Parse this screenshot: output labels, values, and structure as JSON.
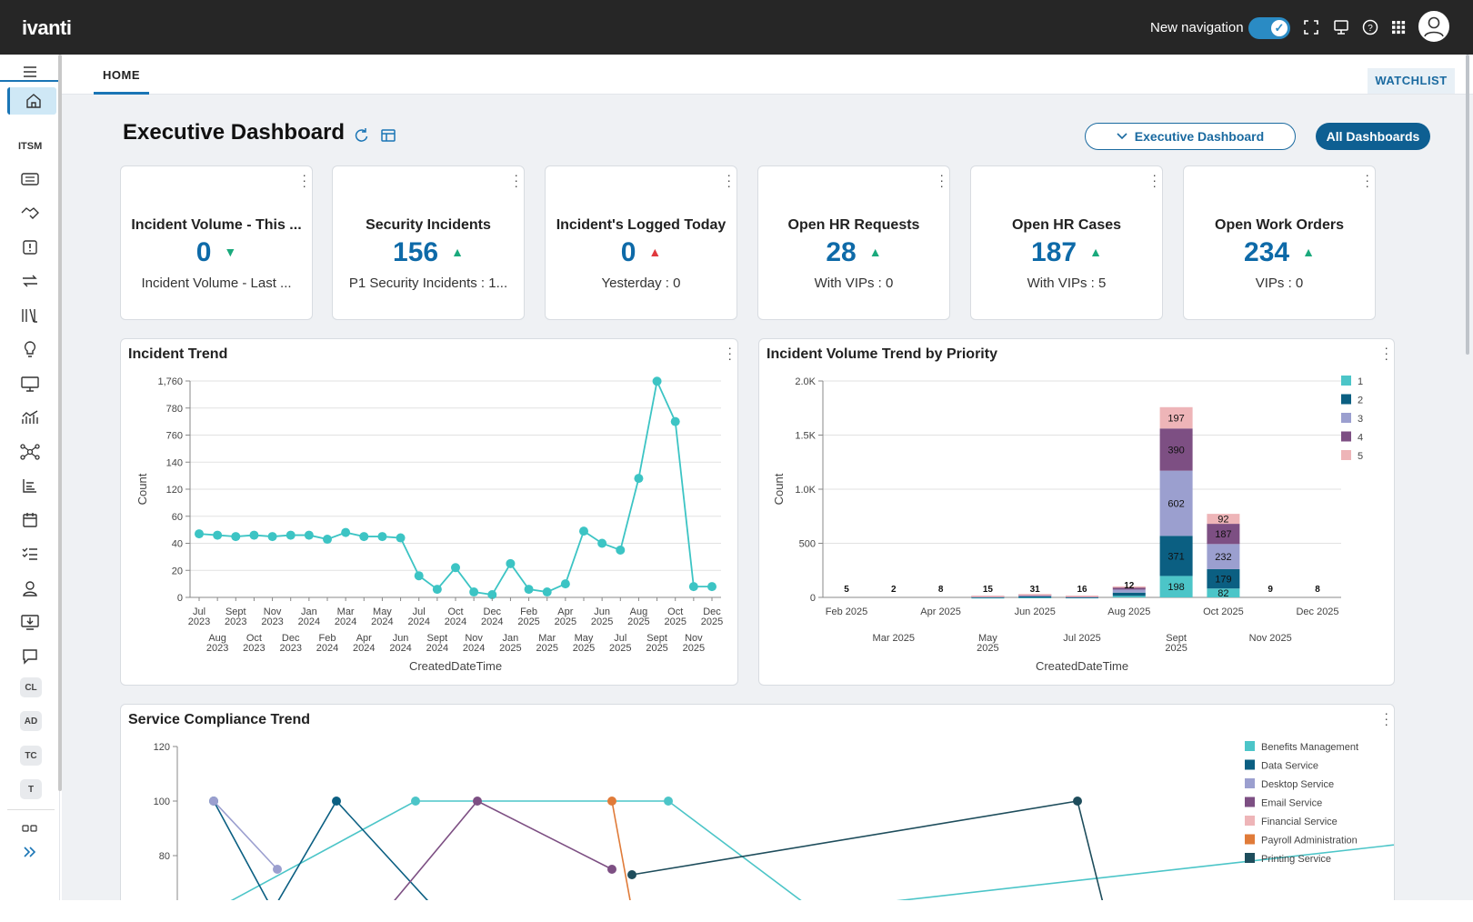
{
  "app": {
    "logo": "ivanti",
    "new_navigation_label": "New navigation"
  },
  "sidebar": {
    "section_label": "ITSM",
    "badges": [
      "CL",
      "AD",
      "TC",
      "T"
    ]
  },
  "tabs": {
    "home": "HOME",
    "watchlist": "WATCHLIST"
  },
  "header": {
    "title": "Executive Dashboard",
    "dropdown_label": "Executive Dashboard",
    "all_dashboards": "All Dashboards"
  },
  "kpis": [
    {
      "title": "Incident Volume - This ...",
      "value": "0",
      "trend": "down",
      "sub": "Incident Volume - Last ..."
    },
    {
      "title": "Security Incidents",
      "value": "156",
      "trend": "up",
      "sub": "P1 Security Incidents : 1..."
    },
    {
      "title": "Incident's Logged Today",
      "value": "0",
      "trend": "up-red",
      "sub": "Yesterday : 0"
    },
    {
      "title": "Open HR Requests",
      "value": "28",
      "trend": "up",
      "sub": "With VIPs : 0"
    },
    {
      "title": "Open HR Cases",
      "value": "187",
      "trend": "up",
      "sub": "With VIPs : 5"
    },
    {
      "title": "Open Work Orders",
      "value": "234",
      "trend": "up",
      "sub": "VIPs : 0"
    }
  ],
  "colors": {
    "teal": "#3cc4c4",
    "up": "#1aa97c",
    "down": "#1aa97c",
    "red": "#e0393e",
    "accent": "#0e6aa8"
  },
  "chart_data": [
    {
      "type": "line",
      "title": "Incident Trend",
      "xlabel": "CreatedDateTime",
      "ylabel": "Count",
      "y_ticks": [
        "0",
        "20",
        "40",
        "60",
        "120",
        "140",
        "760",
        "780",
        "1,760"
      ],
      "x_labels_top": [
        "Jul 2023",
        "Sept 2023",
        "Nov 2023",
        "Jan 2024",
        "Mar 2024",
        "May 2024",
        "Jul 2024",
        "Oct 2024",
        "Dec 2024",
        "Feb 2025",
        "Apr 2025",
        "Jun 2025",
        "Aug 2025",
        "Oct 2025",
        "Dec 2025"
      ],
      "x_labels_bottom": [
        "Aug 2023",
        "Oct 2023",
        "Dec 2023",
        "Feb 2024",
        "Apr 2024",
        "Jun 2024",
        "Sept 2024",
        "Nov 2024",
        "Jan 2025",
        "Mar 2025",
        "May 2025",
        "Jul 2025",
        "Sept 2025",
        "Nov 2025"
      ],
      "series": [
        {
          "values": [
            47,
            46,
            45,
            46,
            45,
            46,
            46,
            43,
            48,
            45,
            45,
            44,
            16,
            6,
            22,
            4,
            2,
            25,
            6,
            4,
            10,
            49,
            40,
            35,
            128,
            1750,
            770,
            8,
            8
          ]
        }
      ]
    },
    {
      "type": "bar",
      "stacked": true,
      "title": "Incident Volume Trend by Priority",
      "xlabel": "CreatedDateTime",
      "ylabel": "Count",
      "y_ticks": [
        "0",
        "500",
        "1.0K",
        "1.5K",
        "2.0K"
      ],
      "ylim": [
        0,
        2000
      ],
      "x_labels_top": [
        "Feb 2025",
        "Apr 2025",
        "Jun 2025",
        "Aug 2025",
        "Oct 2025",
        "Dec 2025"
      ],
      "x_labels_bottom": [
        "Mar 2025",
        "May 2025",
        "Jul 2025",
        "Sept 2025",
        "Nov 2025"
      ],
      "categories": [
        "Feb 2025",
        "Mar 2025",
        "Apr 2025",
        "May 2025",
        "Jun 2025",
        "Jul 2025",
        "Aug 2025",
        "Sept 2025",
        "Oct 2025",
        "Nov 2025",
        "Dec 2025"
      ],
      "totals_labels": [
        "5",
        "2",
        "8",
        "15",
        "31",
        "16",
        "12",
        "",
        "",
        "9",
        "8"
      ],
      "series": [
        {
          "name": "1",
          "color": "#4cc5c8",
          "values": [
            0,
            0,
            0,
            3,
            5,
            4,
            14,
            198,
            82,
            0,
            0
          ]
        },
        {
          "name": "2",
          "color": "#0b5f82",
          "values": [
            0,
            0,
            0,
            4,
            4,
            2,
            30,
            371,
            179,
            0,
            0
          ]
        },
        {
          "name": "3",
          "color": "#9b9fcf",
          "values": [
            0,
            0,
            0,
            5,
            15,
            6,
            28,
            602,
            232,
            0,
            0
          ]
        },
        {
          "name": "4",
          "color": "#7d4f83",
          "values": [
            0,
            0,
            0,
            2,
            3,
            2,
            22,
            390,
            187,
            0,
            0
          ]
        },
        {
          "name": "5",
          "color": "#eeb5b8",
          "values": [
            0,
            0,
            0,
            1,
            4,
            2,
            8,
            197,
            92,
            0,
            0
          ]
        }
      ],
      "segment_labels": [
        {
          "cat": 7,
          "labels": [
            "198",
            "371",
            "602",
            "390",
            "197"
          ]
        },
        {
          "cat": 8,
          "labels": [
            "82",
            "179",
            "232",
            "187",
            "92"
          ]
        }
      ]
    },
    {
      "type": "line",
      "title": "Service Compliance Trend",
      "y_ticks": [
        "80",
        "100",
        "120"
      ],
      "ylim": [
        60,
        120
      ],
      "series": [
        {
          "name": "Benefits Management",
          "color": "#4cc5c8",
          "points": [
            [
              40,
              60
            ],
            [
              262,
              100
            ],
            [
              540,
              100
            ],
            [
              700,
              60
            ],
            [
              1500,
              90
            ]
          ]
        },
        {
          "name": "Data Service",
          "color": "#0b5f82",
          "points": [
            [
              40,
              100
            ],
            [
              105,
              60
            ],
            [
              175,
              100
            ],
            [
              285,
              60
            ]
          ]
        },
        {
          "name": "Desktop Service",
          "color": "#9b9fcf",
          "points": [
            [
              40,
              100
            ],
            [
              110,
              75
            ]
          ]
        },
        {
          "name": "Email Service",
          "color": "#7d4f83",
          "points": [
            [
              230,
              60
            ],
            [
              330,
              100
            ],
            [
              478,
              75
            ]
          ]
        },
        {
          "name": "Financial Service",
          "color": "#eeb5b8",
          "points": []
        },
        {
          "name": "Payroll Administration",
          "color": "#e07b39",
          "points": [
            [
              478,
              100
            ],
            [
              500,
              60
            ]
          ]
        },
        {
          "name": "Printing Service",
          "color": "#1e4d5c",
          "points": [
            [
              500,
              73
            ],
            [
              990,
              100
            ],
            [
              1020,
              60
            ]
          ]
        }
      ]
    }
  ]
}
